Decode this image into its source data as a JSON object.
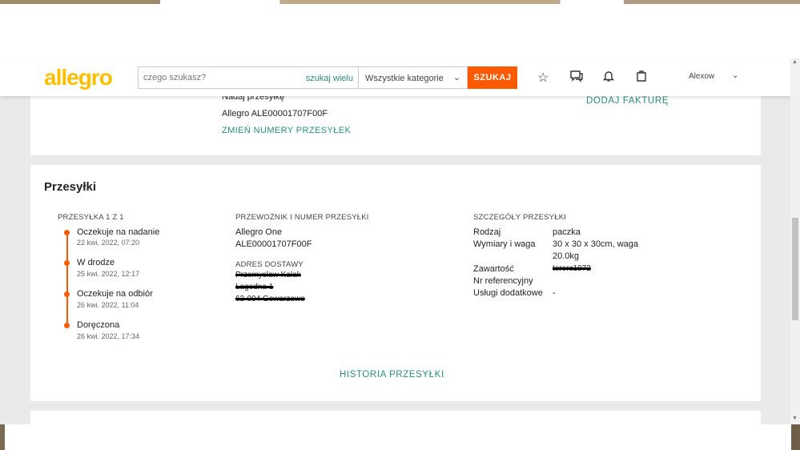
{
  "header": {
    "logo": "allegro",
    "search_placeholder": "czego szukasz?",
    "search_wide_label": "szukaj wielu",
    "category": "Wszystkie kategorie",
    "category_chevron": "⌄",
    "search_button": "SZUKAJ",
    "user_name": "Alexow",
    "user_chevron": "⌄",
    "icons": [
      "star-icon",
      "chat-icon",
      "bell-icon",
      "cart-icon"
    ]
  },
  "top_card": {
    "send_link": "Nadaj przesyłkę",
    "tracking": "Allegro ALE00001707F00F",
    "change_numbers": "ZMIEŃ NUMERY PRZESYŁEK",
    "add_invoice": "DODAJ FAKTURĘ"
  },
  "shipments": {
    "title": "Przesyłki",
    "package_label": "PRZESYŁKA 1 Z 1",
    "timeline": [
      {
        "status": "Oczekuje na nadanie",
        "date": "22 kwi. 2022, 07:20"
      },
      {
        "status": "W drodze",
        "date": "25 kwi. 2022, 12:17"
      },
      {
        "status": "Oczekuje na odbiór",
        "date": "26 kwi. 2022, 11:04"
      },
      {
        "status": "Doręczona",
        "date": "26 kwi. 2022, 17:34"
      }
    ],
    "carrier_label": "PRZEWOŹNIK I NUMER PRZESYŁKI",
    "carrier_name": "Allegro One",
    "carrier_number": "ALE00001707F00F",
    "address_label": "ADRES DOSTAWY",
    "address_lines": [
      "Przemysław Kalak",
      "Łagodna 1",
      "63-004 Gowarzewo"
    ],
    "details_label": "SZCZEGÓŁY PRZESYŁKI",
    "details": [
      {
        "key": "Rodzaj",
        "value": "paczka"
      },
      {
        "key": "Wymiary i waga",
        "value": "30 x 30 x 30cm, waga"
      },
      {
        "key": "",
        "value": "20.0kg"
      },
      {
        "key": "Zawartość",
        "value": "tererc1972"
      },
      {
        "key": "Nr referencyjny",
        "value": ""
      },
      {
        "key": "Usługi dodatkowe",
        "value": "-"
      }
    ],
    "history_link": "HISTORIA PRZESYŁKI"
  },
  "colors": {
    "accent": "#ff5a00",
    "link": "#2a8e7c",
    "logo": "#ffbf00"
  }
}
